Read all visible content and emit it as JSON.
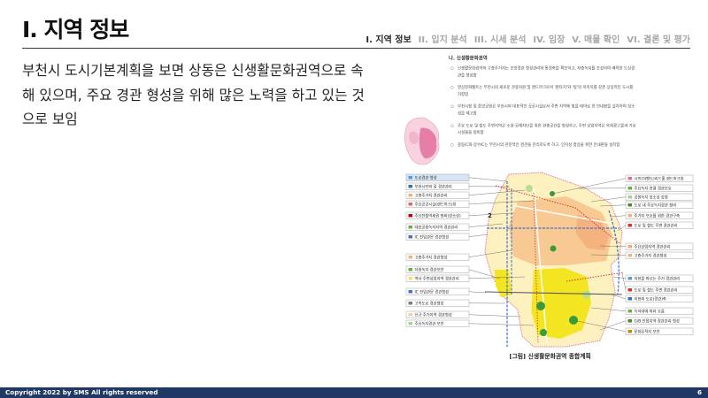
{
  "header": {
    "title": "I. 지역 정보"
  },
  "nav": {
    "items": [
      {
        "label": "I. 지역 정보",
        "active": true
      },
      {
        "label": "II. 입지 분석",
        "active": false
      },
      {
        "label": "III. 시세 분석",
        "active": false
      },
      {
        "label": "IV. 임장",
        "active": false
      },
      {
        "label": "V. 매물 확인",
        "active": false
      },
      {
        "label": "VI. 결론 및 평가",
        "active": false
      }
    ]
  },
  "body": {
    "lines": [
      "부천시 도시기본계획을 보면 상동은 신생활문화권역으로 속",
      "해 있으며, 주요 경관 형성을 위해 많은 노력을 하고 있는 것",
      "으로 보임"
    ]
  },
  "figure": {
    "heading": "나. 신생활문화권역",
    "bullets": [
      "신생활문화권역의 고층주거지는 조망경관 형성관리와 통경축을 확보하고, 저층녹지를 조성하여 쾌적한 도심경관을 형성함",
      "영상문화벨트는 부천시의 새로운 관광자원 및 랜드마크로서 '판타지'와 '빛'의 이미지를 갖춘 상징적인 도시를 지향함",
      "부천시청 및 중앙공원은 부천시의 대표적인 공공시설로서 주변 지역에 빛을 테마로 한 안내판을 설치하여 장소성을 제고함",
      "주요 도로 및 철도 주변지역은 소음·공해차단을 위한 완충공간을 형성하고, 주변 상업지역은 옥외광고물과 가로시설물을 정비함",
      "중동IC와 장수IC는 부천시의 관문적인 경관을 관리하도록 하고, 인지성 향상을 위한 안내판을 설치함"
    ],
    "map_marker": "2",
    "labels_left": [
      {
        "text": "도로경관 형성",
        "icon_color": "#5b9bd5",
        "box_color": "#d6e6f7"
      },
      {
        "text": "부천시민의 길 경관관리",
        "icon_color": "#2e75b6"
      },
      {
        "text": "고층주거지 경관관리",
        "icon_color": "#f4b183"
      },
      {
        "text": "주요공공시설(랜드마크)화",
        "icon_color": "#e06666"
      },
      {
        "text": "주요전철역세권 정비(장소성)",
        "icon_color": "#c00000"
      },
      {
        "text": "대표공원녹지지역 경관관리",
        "icon_color": "#70ad47"
      },
      {
        "text": "IC 진입관문 경관형성",
        "icon_color": "#4472c4"
      },
      {
        "text": "고층주거지 경관형성",
        "icon_color": "#f4b183"
      },
      {
        "text": "자원녹지 경관보전",
        "icon_color": "#70ad47"
      },
      {
        "text": "역사 주변상업지역 경관관리",
        "icon_color": "#ffd966"
      },
      {
        "text": "IC 진입관문 경관형성",
        "icon_color": "#4472c4"
      },
      {
        "text": "고속도로 경관형성",
        "icon_color": "#7f7f7f"
      },
      {
        "text": "신규 주거지역 경관형성",
        "icon_color": "#f8cbad"
      },
      {
        "text": "주요녹지경관 보전",
        "icon_color": "#a9d18e"
      }
    ],
    "labels_right": [
      {
        "text": "시민(이벤트)리드홀 랜드마크화",
        "icon_color": "#e46c9a"
      },
      {
        "text": "주요녹지 연결 경관보호",
        "icon_color": "#70ad47"
      },
      {
        "text": "공원녹지 장소성 강화",
        "icon_color": "#a9d18e"
      },
      {
        "text": "도로 내 주요녹지경관 정비",
        "icon_color": "#548235"
      },
      {
        "text": "주거지 보호를 위한 경관구축",
        "icon_color": "#f4b183"
      },
      {
        "text": "도로 및 철도 주변 경관관리",
        "icon_color": "#d9342b"
      },
      {
        "text": "주요상업지역 경관관리",
        "icon_color": "#f2a977"
      },
      {
        "text": "고층주거지 경관형성",
        "icon_color": "#f4b183"
      },
      {
        "text": "하천을 따르는 주거 경관관리",
        "icon_color": "#5b9bd5"
      },
      {
        "text": "도로 및 철도 주변 경관관리",
        "icon_color": "#d9342b"
      },
      {
        "text": "하천의 도로(경관)축",
        "icon_color": "#2e75b6"
      },
      {
        "text": "녹지대에 따라 흐름",
        "icon_color": "#70ad47"
      },
      {
        "text": "G/B 인접지역 경관관리 형성",
        "icon_color": "#548235"
      },
      {
        "text": "문화유적지 보전",
        "icon_color": "#bf9000"
      }
    ],
    "caption": "[그림] 신생활문화권역 종합계획"
  },
  "footer": {
    "copyright": "Copyright 2022 by SMS All rights reserved",
    "page_number": "6"
  },
  "colors": {
    "footer_bar": "#1f3864",
    "nav_active": "#262626",
    "nav_inactive": "#a6a6a6"
  }
}
